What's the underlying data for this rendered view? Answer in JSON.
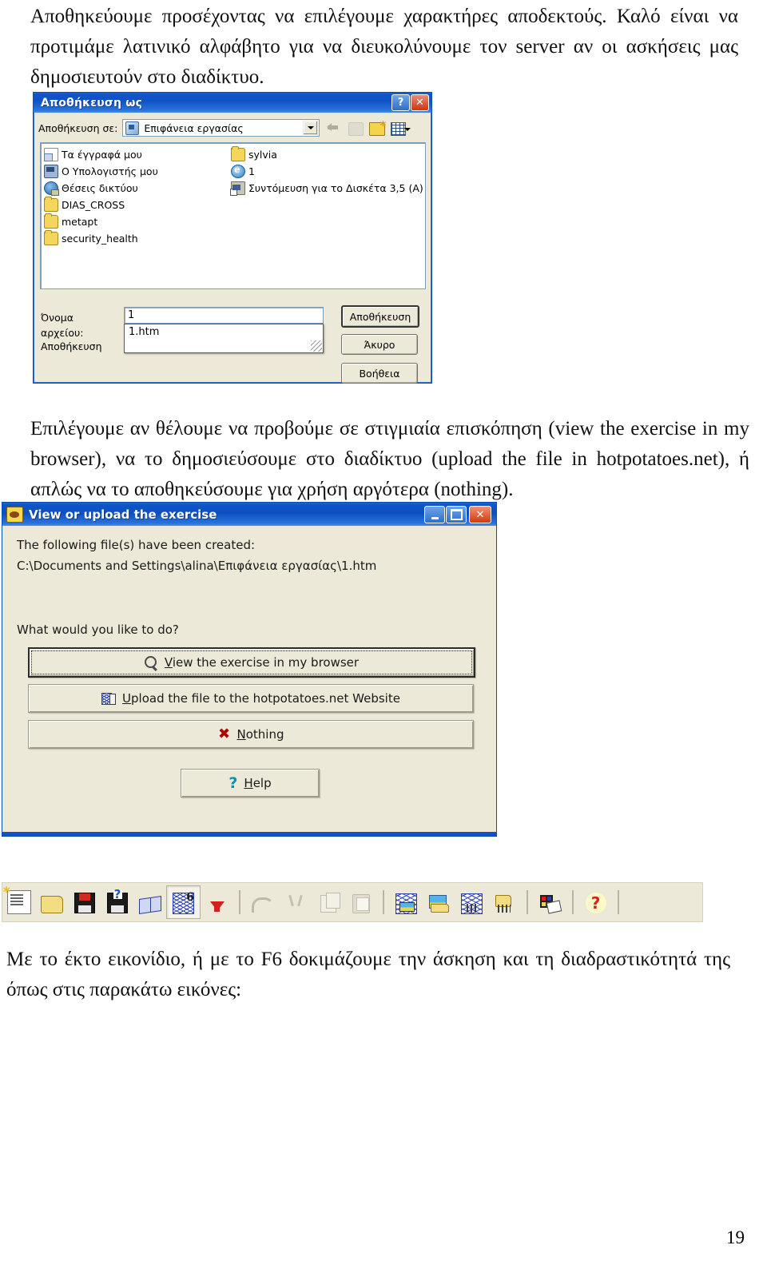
{
  "document": {
    "paragraph_top": "Αποθηκεύουμε προσέχοντας να επιλέγουμε χαρακτήρες αποδεκτούς. Καλό είναι να προτιμάμε λατινικό αλφάβητο για να διευκολύνουμε τον server αν οι ασκήσεις μας δημοσιευτούν στο διαδίκτυο.",
    "paragraph_middle": "Επιλέγουμε αν θέλουμε να προβούμε σε στιγμιαία επισκόπηση (view the exercise in my browser), να το δημοσιεύσουμε στο διαδίκτυο (upload the file in hotpotatoes.net), ή απλώς να το αποθηκεύσουμε για χρήση αργότερα (nothing).",
    "paragraph_bottom": "Με το έκτο εικονίδιο, ή με το F6 δοκιμάζουμε την άσκηση και τη διαδραστικότητά της όπως στις παρακάτω εικόνες:",
    "page_number": "19"
  },
  "save_as_dialog": {
    "title": "Αποθήκευση ως",
    "help_button": "?",
    "close_button": "✕",
    "look_in_label": "Αποθήκευση σε:",
    "look_in_value": "Επιφάνεια εργασίας",
    "toolbar_icons": [
      "back-arrow-icon",
      "up-folder-icon",
      "new-folder-icon",
      "views-icon"
    ],
    "file_list_column_1": [
      {
        "label": "Τα έγγραφά μου",
        "icon": "my-documents-icon"
      },
      {
        "label": "Ο Υπολογιστής μου",
        "icon": "my-computer-icon"
      },
      {
        "label": "Θέσεις δικτύου",
        "icon": "network-places-icon"
      },
      {
        "label": "DIAS_CROSS",
        "icon": "folder-icon"
      },
      {
        "label": "metapt",
        "icon": "folder-icon"
      },
      {
        "label": "security_health",
        "icon": "folder-icon"
      }
    ],
    "file_list_column_2": [
      {
        "label": "sylvia",
        "icon": "folder-icon"
      },
      {
        "label": "1",
        "icon": "internet-explorer-document-icon"
      },
      {
        "label": "Συντόμευση για το Δισκέτα 3,5 (A)",
        "icon": "shortcut-floppy-icon"
      }
    ],
    "file_name_label": "Όνομα αρχείου:",
    "file_name_value": "1",
    "autocomplete_suggestion": "1.htm",
    "save_as_type_label": "Αποθήκευση",
    "buttons": {
      "save": "Αποθήκευση",
      "cancel": "Άκυρο",
      "help": "Βοήθεια"
    }
  },
  "view_upload_dialog": {
    "title": "View or upload the exercise",
    "app_icon": "hot-potato-icon",
    "window_buttons": {
      "minimize": "minimize-icon",
      "maximize": "maximize-icon",
      "close": "✕"
    },
    "created_label": "The following file(s) have been created:",
    "created_path": "C:\\Documents and Settings\\alina\\Επιφάνεια εργασίας\\1.htm",
    "question": "What would you like to do?",
    "buttons": {
      "view": {
        "mnemonic": "V",
        "rest": "iew the exercise in my browser",
        "icon": "magnifier-icon"
      },
      "upload": {
        "mnemonic": "U",
        "rest": "pload the file to the hotpotatoes.net Website",
        "icon": "upload-web-icon"
      },
      "nothing": {
        "mnemonic": "N",
        "rest": "othing",
        "icon": "red-x-icon"
      },
      "help": {
        "mnemonic": "H",
        "rest": "elp",
        "icon": "question-mark-icon"
      }
    }
  },
  "hot_potatoes_toolbar": {
    "items": [
      {
        "name": "new-exercise-icon",
        "glyph": "g-new"
      },
      {
        "name": "open-file-icon",
        "glyph": "g-open"
      },
      {
        "name": "save-icon",
        "glyph": "g-save"
      },
      {
        "name": "save-as-icon",
        "glyph": "g-saveas"
      },
      {
        "name": "export-rtf-icon",
        "glyph": "g-book"
      },
      {
        "name": "export-web-page-icon",
        "glyph": "g-web6",
        "pressed": true
      },
      {
        "name": "upload-arrow-icon",
        "glyph": "g-arrow-down"
      },
      {
        "name": "separator-1",
        "glyph": "sep"
      },
      {
        "name": "undo-icon",
        "glyph": "g-undo"
      },
      {
        "name": "cut-icon",
        "glyph": "g-cut"
      },
      {
        "name": "copy-icon",
        "glyph": "g-copy"
      },
      {
        "name": "paste-icon",
        "glyph": "g-paste"
      },
      {
        "name": "separator-2",
        "glyph": "sep"
      },
      {
        "name": "insert-web-picture-icon",
        "glyph": "g-webpic"
      },
      {
        "name": "insert-local-picture-icon",
        "glyph": "g-picfolder"
      },
      {
        "name": "insert-web-link-icon",
        "glyph": "g-weblink"
      },
      {
        "name": "insert-local-link-icon",
        "glyph": "g-folderlink"
      },
      {
        "name": "separator-3",
        "glyph": "sep"
      },
      {
        "name": "configuration-icon",
        "glyph": "g-config"
      },
      {
        "name": "separator-4",
        "glyph": "sep"
      },
      {
        "name": "help-icon",
        "glyph": "g-qmark"
      },
      {
        "name": "separator-5",
        "glyph": "sep"
      }
    ]
  },
  "colors": {
    "titlebar_blue": "#0f52c4",
    "dialog_face": "#ece9d8",
    "close_red": "#cf3512",
    "accent_yellow": "#f4dd80"
  }
}
